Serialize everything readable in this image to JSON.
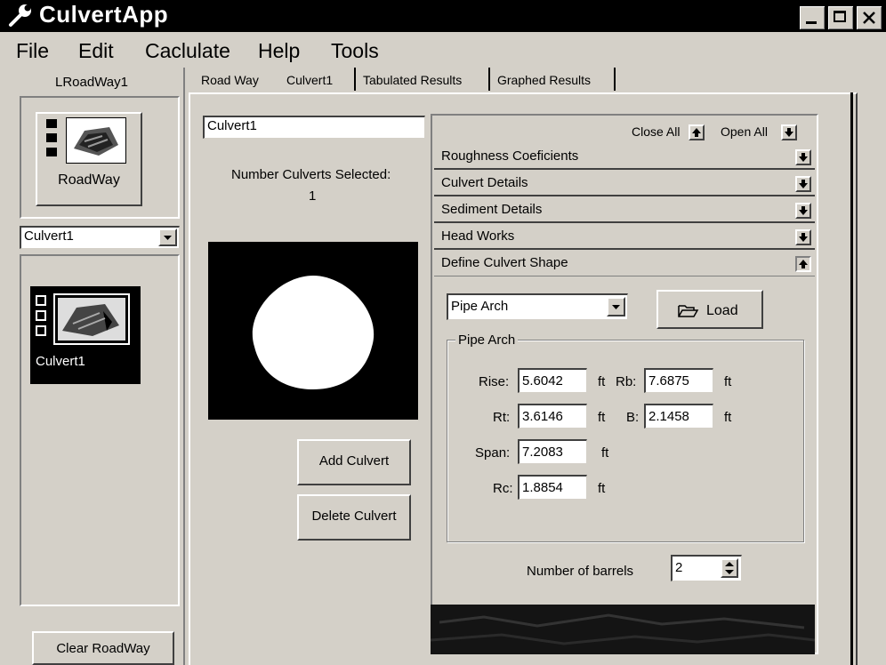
{
  "window": {
    "title": "CulvertApp",
    "minimize": "_",
    "maximize": "□",
    "close": "✕"
  },
  "menu": {
    "file": "File",
    "edit": "Edit",
    "calculate": "Caclulate",
    "help": "Help",
    "tools": "Tools"
  },
  "left_panel": {
    "roadway_header": "LRoadWay1",
    "roadway_label": "RoadWay",
    "culvert_select": "Culvert1",
    "culvert_label": "Culvert1",
    "clear_button": "Clear RoadWay"
  },
  "tabs": [
    "Road Way",
    "Culvert1",
    "Tabulated Results",
    "Graphed Results"
  ],
  "culvert": {
    "name_value": "Culvert1",
    "selected_label": "Number Culverts Selected:",
    "selected_count": "1",
    "add_button": "Add Culvert",
    "delete_button": "Delete Culvert"
  },
  "sections": {
    "close_all": "Close All",
    "open_all": "Open All",
    "items": [
      {
        "label": "Roughness Coeficients",
        "state": "closed"
      },
      {
        "label": "Culvert Details",
        "state": "closed"
      },
      {
        "label": "Sediment Details",
        "state": "closed"
      },
      {
        "label": "Head Works",
        "state": "closed"
      },
      {
        "label": "Define Culvert Shape",
        "state": "open"
      }
    ]
  },
  "shape": {
    "type_value": "Pipe Arch",
    "load_button": "Load",
    "group_title": "Pipe Arch",
    "rise_label": "Rise:",
    "rise_value": "5.6042",
    "rise_unit": "ft",
    "rb_label": "Rb:",
    "rb_value": "7.6875",
    "rb_unit": "ft",
    "rt_label": "Rt:",
    "rt_value": "3.6146",
    "rt_unit": "ft",
    "b_label": "B:",
    "b_value": "2.1458",
    "b_unit": "ft",
    "span_label": "Span:",
    "span_value": "7.2083",
    "span_unit": "ft",
    "rc_label": "Rc:",
    "rc_value": "1.8854",
    "rc_unit": "ft",
    "barrels_label": "Number of barrels",
    "barrels_value": "2"
  },
  "icons": [
    "wrench-icon",
    "roadway-icon",
    "culvert-icon",
    "folder-open-icon",
    "chevron-down-icon",
    "arrow-up-icon",
    "arrow-down-icon",
    "spinner-icon"
  ],
  "colors": {
    "face": "#d4d0c8",
    "title_bar": "#000000",
    "selected_item": "#000000",
    "field": "#ffffff"
  }
}
